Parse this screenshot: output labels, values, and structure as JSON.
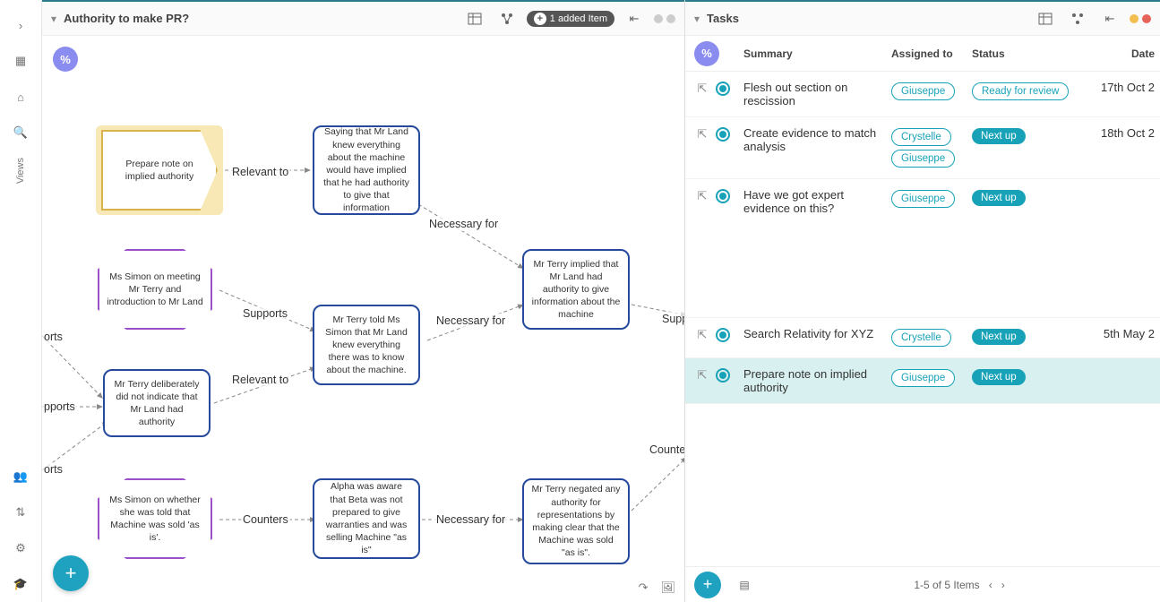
{
  "leftRail": {
    "viewsLabel": "Views"
  },
  "leftPane": {
    "title": "Authority to make PR?",
    "addedBadge": "1 added Item",
    "percentSymbol": "%",
    "nodes": {
      "pent1": "Prepare note on implied authority",
      "rect1": "Saying that Mr Land knew everything about the machine would have implied that he had authority to give that information",
      "oct1": "Ms Simon on meeting Mr Terry and introduction to Mr Land",
      "rect2": "Mr Terry told Ms Simon that Mr Land knew everything there was to know about the machine.",
      "rect3": "Mr Terry implied that Mr Land had authority to give information about the machine",
      "rect4": "Mr Terry deliberately did not indicate that Mr Land had authority",
      "oct2": "Ms Simon on whether she was told that Machine was sold 'as is'.",
      "rect5": "Alpha was aware that Beta was not prepared to give warranties and was selling Machine \"as is\"",
      "rect6": "Mr Terry negated any authority for representations by making clear that the Machine was sold \"as is\"."
    },
    "edgeLabels": {
      "relevant1": "Relevant to",
      "necessary1": "Necessary for",
      "supports1": "Supports",
      "necessary2": "Necessary for",
      "relevant2": "Relevant to",
      "counters1": "Counters",
      "necessary3": "Necessary for",
      "supp_cut": "Supp",
      "counte_cut": "Counte",
      "orts1": "orts",
      "pports": "pports",
      "orts2": "orts"
    }
  },
  "rightPane": {
    "title": "Tasks",
    "percentSymbol": "%",
    "columns": {
      "summary": "Summary",
      "assigned": "Assigned to",
      "status": "Status",
      "date": "Date"
    },
    "rows": [
      {
        "summary": "Flesh out section on rescission",
        "assignees": [
          "Giuseppe"
        ],
        "status": "Ready for review",
        "statusStyle": "teal-out",
        "date": "17th Oct 2"
      },
      {
        "summary": "Create evidence to match analysis",
        "assignees": [
          "Crystelle",
          "Giuseppe"
        ],
        "status": "Next up",
        "statusStyle": "teal",
        "date": "18th Oct 2"
      },
      {
        "summary": "Have we got expert evidence on this?",
        "assignees": [
          "Giuseppe"
        ],
        "status": "Next up",
        "statusStyle": "teal",
        "date": ""
      },
      {
        "summary": "Search Relativity for XYZ",
        "assignees": [
          "Crystelle"
        ],
        "status": "Next up",
        "statusStyle": "teal",
        "date": "5th May 2"
      },
      {
        "summary": "Prepare note on implied authority",
        "assignees": [
          "Giuseppe"
        ],
        "status": "Next up",
        "statusStyle": "teal",
        "date": "",
        "highlight": true
      }
    ],
    "footer": {
      "pagination": "1-5 of 5 Items"
    }
  }
}
